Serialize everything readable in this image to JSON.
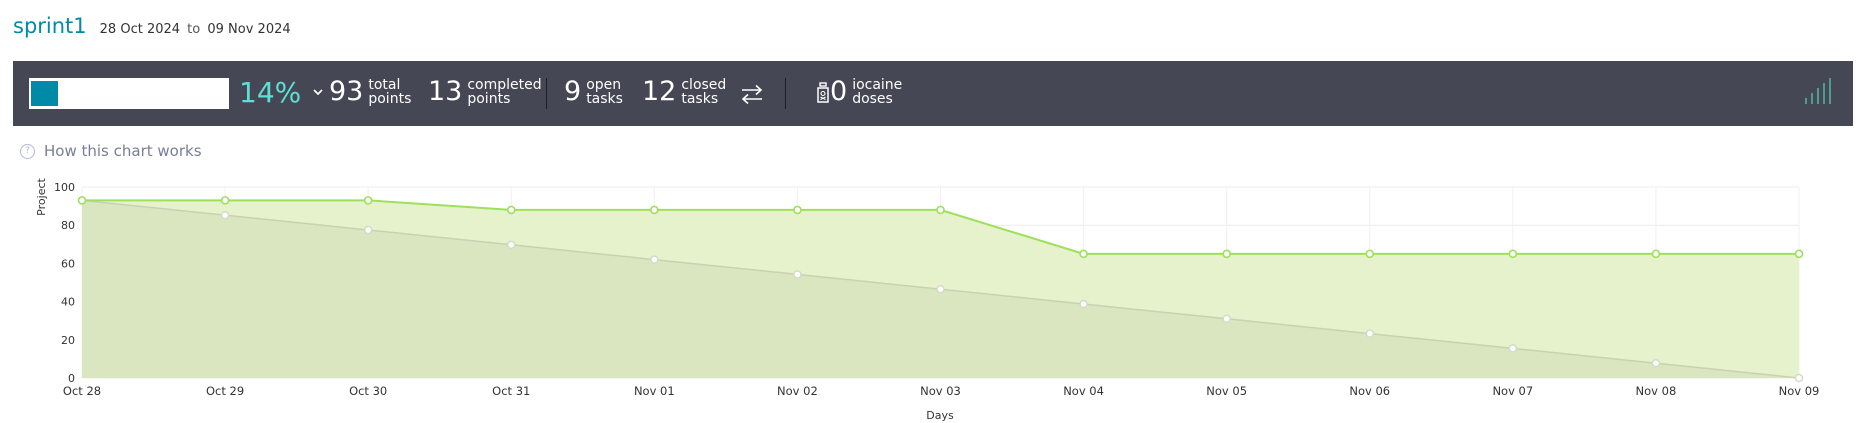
{
  "sprint": {
    "name": "sprint1",
    "start_date": "28 Oct 2024",
    "date_separator": "to",
    "end_date": "09 Nov 2024"
  },
  "summary": {
    "progress_fraction": 0.14,
    "percent_label": "14%",
    "total_points": {
      "value": "93",
      "label_line1": "total",
      "label_line2": "points"
    },
    "completed_points": {
      "value": "13",
      "label_line1": "completed",
      "label_line2": "points"
    },
    "open_tasks": {
      "value": "9",
      "label_line1": "open",
      "label_line2": "tasks"
    },
    "closed_tasks": {
      "value": "12",
      "label_line1": "closed",
      "label_line2": "tasks"
    },
    "iocaine_doses": {
      "value": "0",
      "label_line1": "iocaine",
      "label_line2": "doses"
    },
    "icons": [
      "chevron-down-icon",
      "swap-arrows-icon",
      "iocaine-bottle-icon",
      "signal-bars-icon"
    ]
  },
  "help": {
    "question_glyph": "?",
    "link_text": "How this chart works"
  },
  "colors": {
    "brand": "#008aa8",
    "percent_text": "#5ce0d6",
    "summary_bg": "#454755",
    "actual_line": "#9ee05c",
    "actual_fill": "#e6f2cc",
    "ideal_line": "#c8d2b0",
    "ideal_fill": "#dae6bf"
  },
  "chart_data": {
    "type": "area",
    "xlabel": "Days",
    "ylabel": "Project",
    "ylim": [
      0,
      100
    ],
    "yticks": [
      0,
      20,
      40,
      60,
      80,
      100
    ],
    "grid": true,
    "categories": [
      "Oct 28",
      "Oct 29",
      "Oct 30",
      "Oct 31",
      "Nov 01",
      "Nov 02",
      "Nov 03",
      "Nov 04",
      "Nov 05",
      "Nov 06",
      "Nov 07",
      "Nov 08",
      "Nov 09"
    ],
    "series": [
      {
        "values": [
          93,
          93,
          93,
          88,
          88,
          88,
          88,
          65,
          65,
          65,
          65,
          65,
          65
        ]
      },
      {
        "values": [
          93,
          85.25,
          77.5,
          69.75,
          62,
          54.25,
          46.5,
          38.75,
          31,
          23.25,
          15.5,
          7.75,
          0
        ]
      }
    ]
  }
}
